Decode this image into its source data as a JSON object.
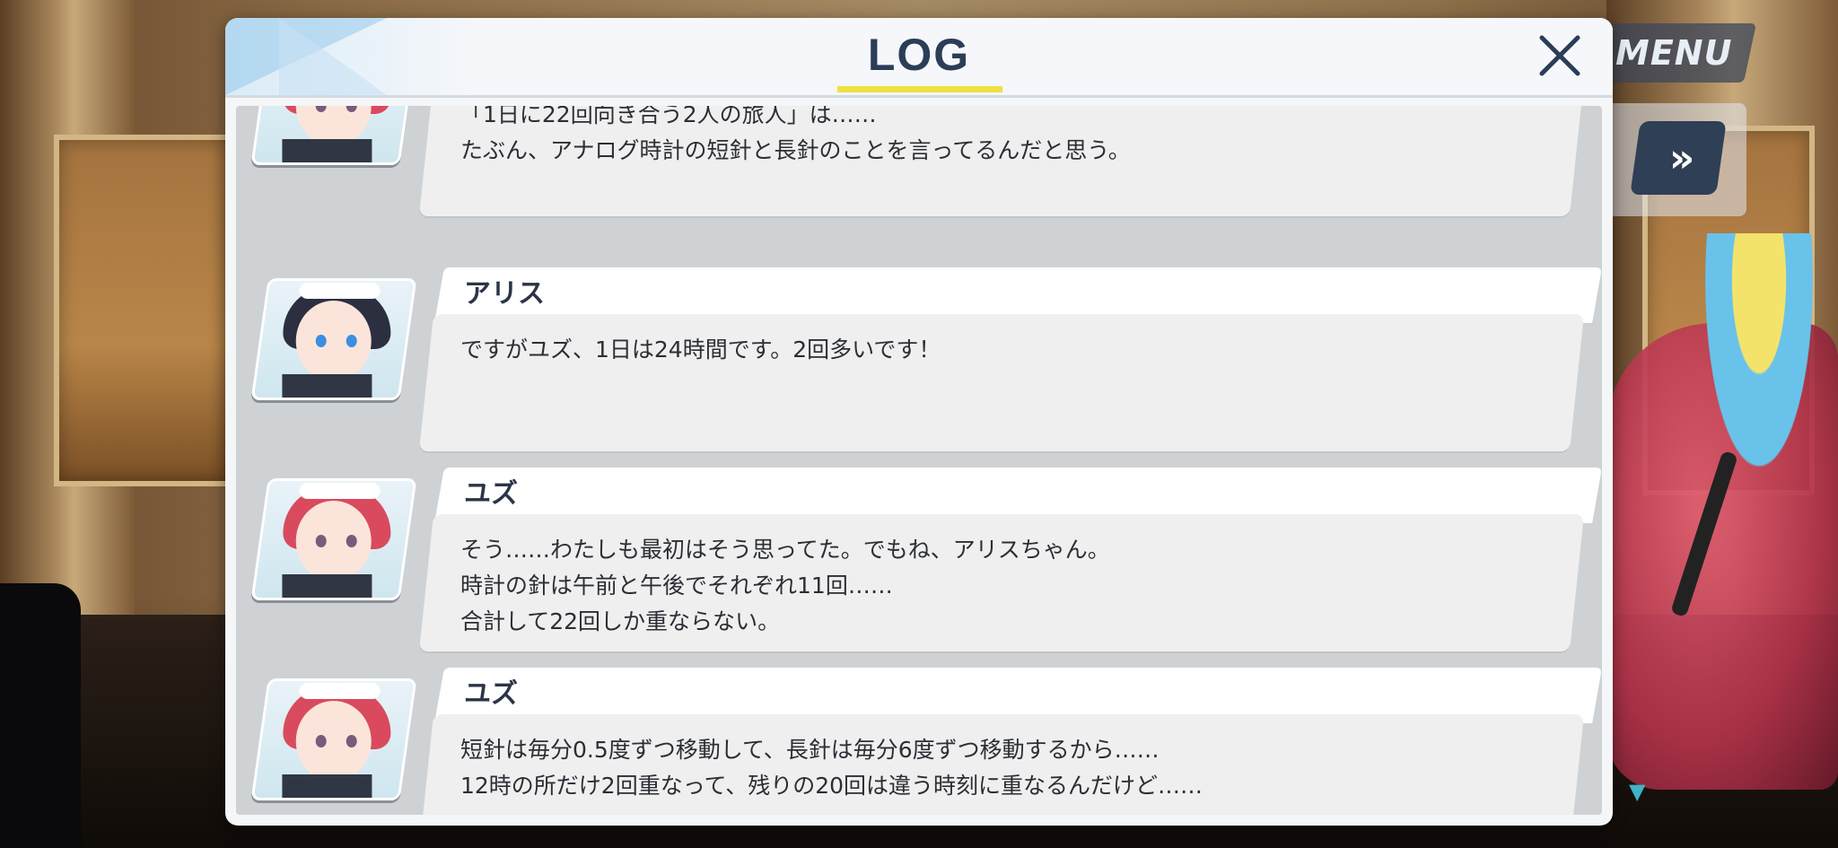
{
  "hud": {
    "menu_label": "MENU",
    "fast_forward_label": "»"
  },
  "dialog": {
    "title": "LOG",
    "accent_color": "#f0e043",
    "close_label": "×"
  },
  "entries": [
    {
      "speaker": "",
      "avatar": "yuzu",
      "text": "「1日に22回向き合う2人の旅人」は……\nたぶん、アナログ時計の短針と長針のことを言ってるんだと思う。"
    },
    {
      "speaker": "アリス",
      "avatar": "alice",
      "text": "ですがユズ、1日は24時間です。2回多いです！"
    },
    {
      "speaker": "ユズ",
      "avatar": "yuzu",
      "text": "そう……わたしも最初はそう思ってた。でもね、アリスちゃん。\n時計の針は午前と午後でそれぞれ11回……\n合計して22回しか重ならない。"
    },
    {
      "speaker": "ユズ",
      "avatar": "yuzu",
      "text": "短針は毎分0.5度ずつ移動して、長針は毎分6度ずつ移動するから……\n12時の所だけ2回重なって、残りの20回は違う時刻に重なるんだけど……"
    }
  ]
}
